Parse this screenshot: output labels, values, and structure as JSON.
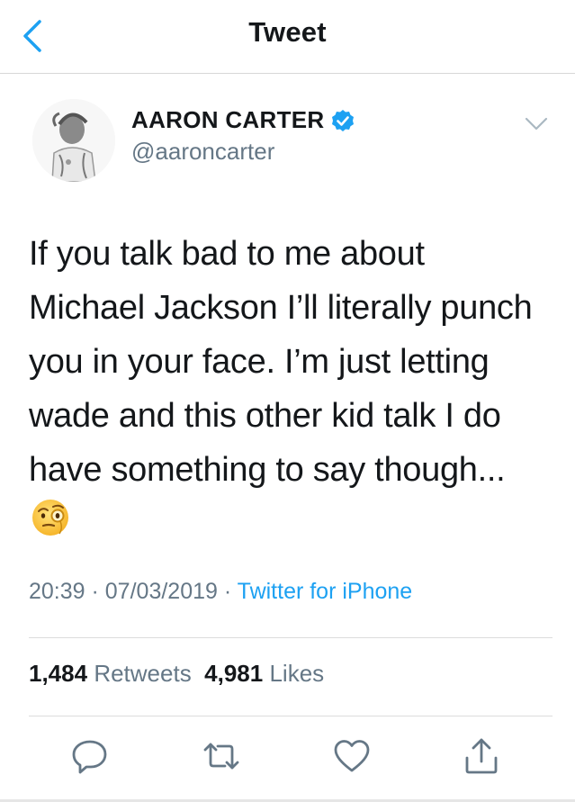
{
  "header": {
    "title": "Tweet",
    "back_icon": "chevron-left-icon"
  },
  "author": {
    "display_name": "AARON CARTER",
    "handle": "@aaroncarter",
    "verified": true,
    "verified_color": "#1da1f2"
  },
  "tweet": {
    "text": "If you talk bad to me about\nMichael Jackson I’ll literally punch\nyou in your face. I’m just letting\nwade and this other kid talk I do\nhave something to say though...",
    "emoji": "face-with-monocle-emoji"
  },
  "meta": {
    "time": "20:39",
    "separator": " · ",
    "date": "07/03/2019",
    "source": "Twitter for iPhone"
  },
  "stats": {
    "retweets_count": "1,484",
    "retweets_label": "Retweets",
    "likes_count": "4,981",
    "likes_label": "Likes"
  },
  "actions": [
    "reply-icon",
    "retweet-icon",
    "like-icon",
    "share-icon"
  ],
  "colors": {
    "accent": "#1da1f2",
    "secondary_text": "#657786",
    "primary_text": "#14171a"
  }
}
